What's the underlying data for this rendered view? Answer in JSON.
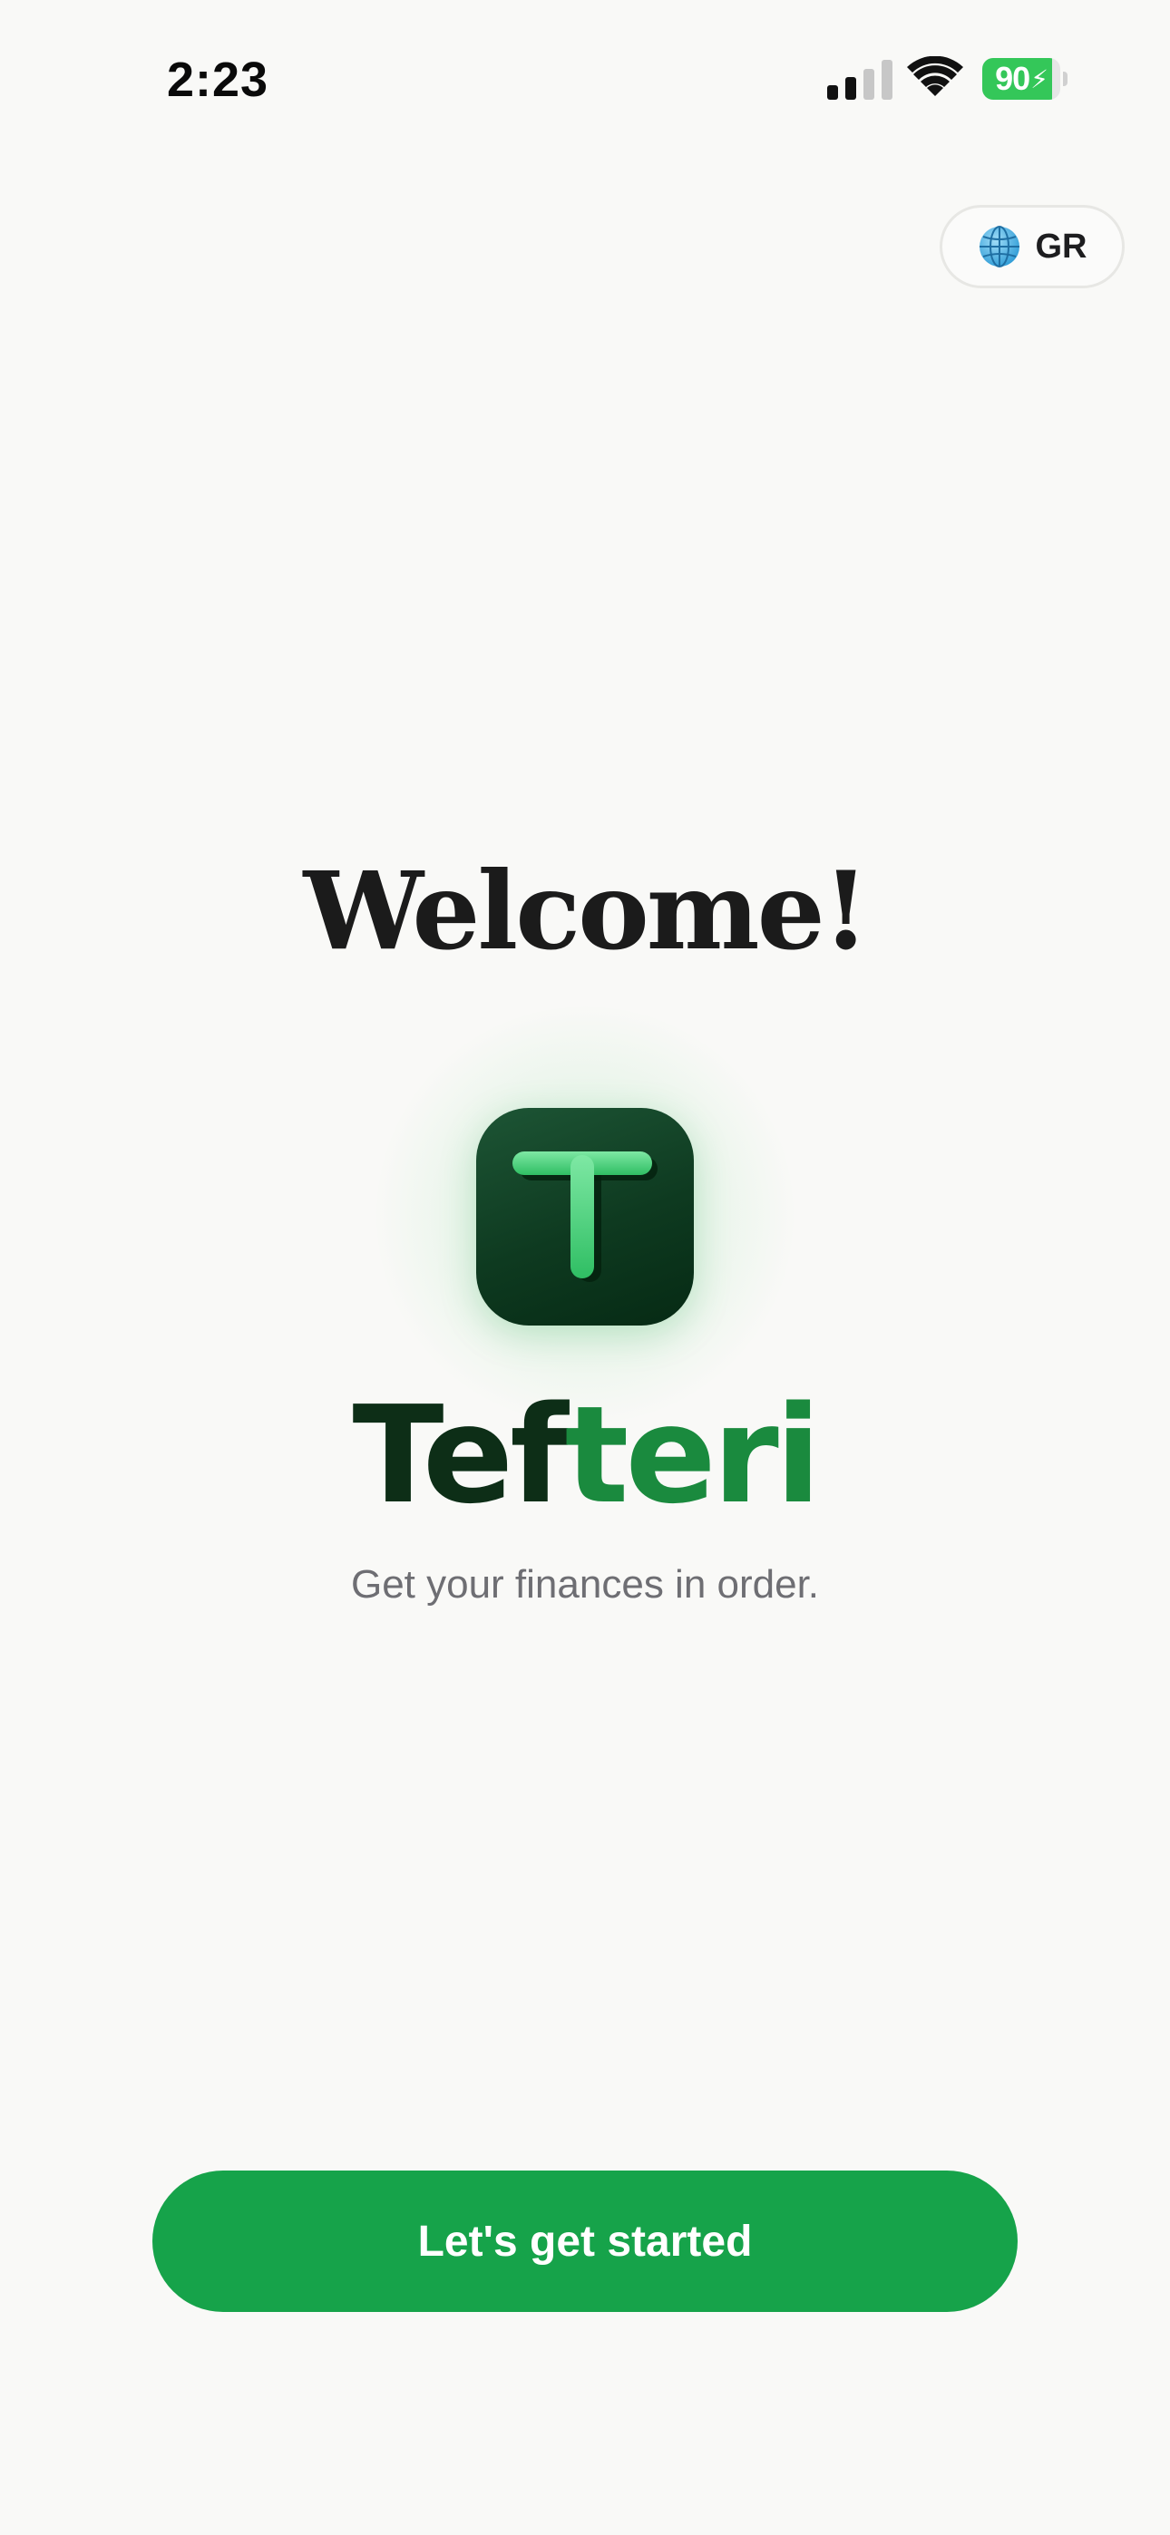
{
  "status_bar": {
    "time": "2:23",
    "battery_percent": "90",
    "battery_level": 0.9,
    "battery_charging": true,
    "icons": [
      "cellular-signal-icon",
      "wifi-icon",
      "battery-icon"
    ]
  },
  "language": {
    "label": "GR",
    "icon": "globe-icon"
  },
  "welcome": {
    "title": "Welcome!"
  },
  "brand": {
    "name_part_dark": "Tef",
    "name_part_green": "teri",
    "icon_letter": "T",
    "icon": "app-logo-icon"
  },
  "tagline": "Get your finances in order.",
  "cta": {
    "label": "Let's get started"
  },
  "colors": {
    "background": "#f9f9f7",
    "accent_green": "#16a34a",
    "brand_dark": "#0d2e17",
    "brand_green": "#1a8a3e",
    "battery_green": "#34c759",
    "tagline_gray": "#6e6e73"
  }
}
